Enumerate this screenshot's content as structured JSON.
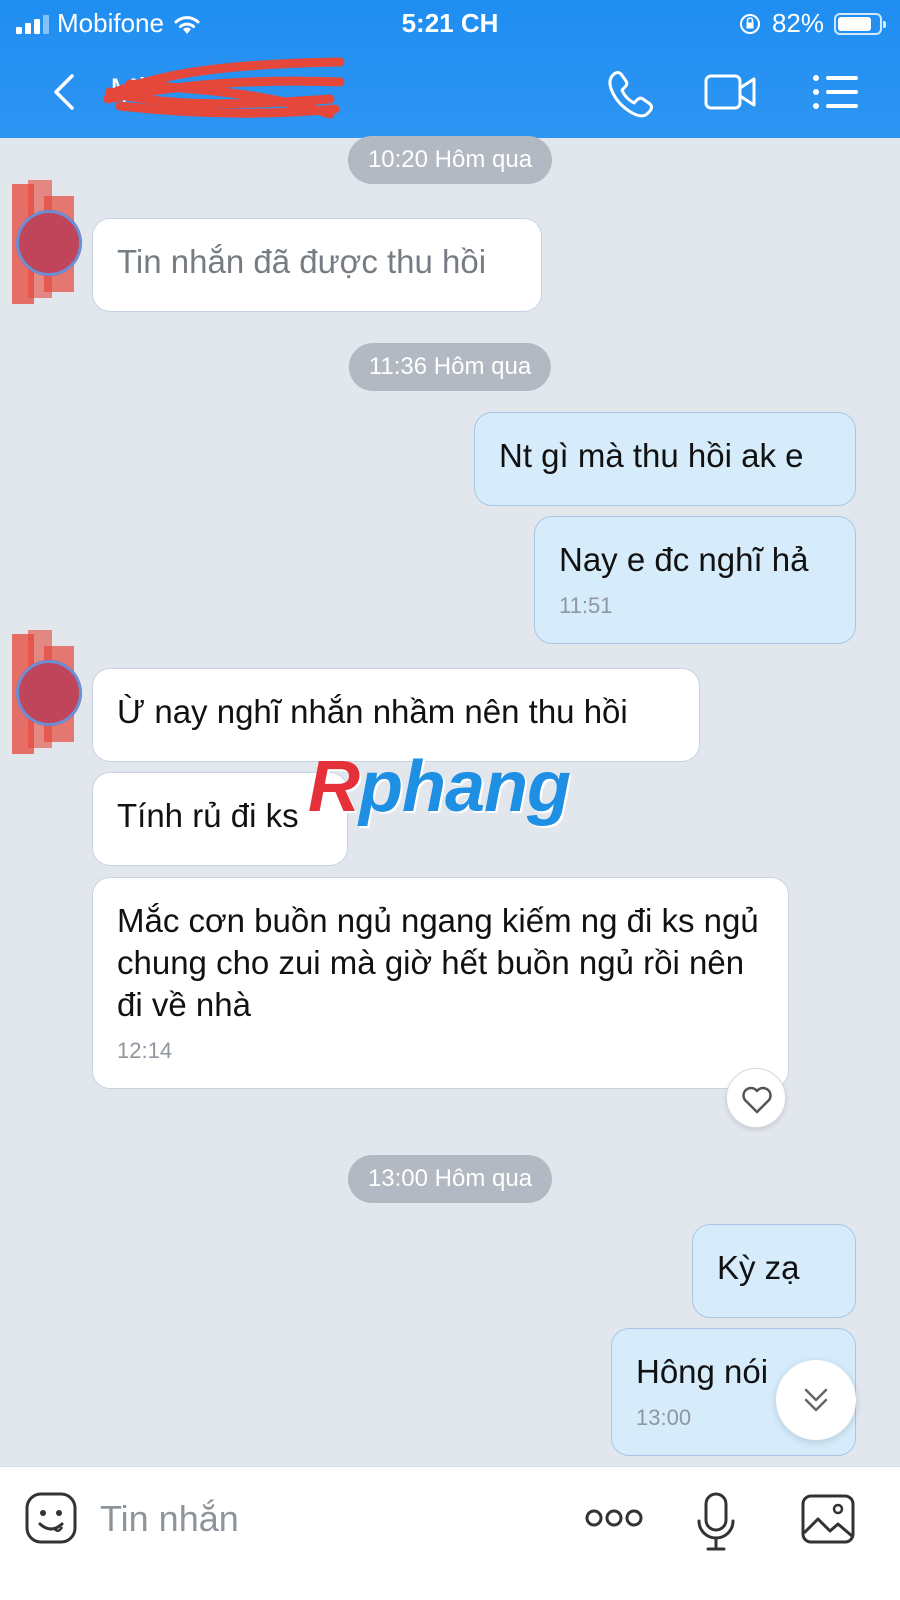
{
  "status_bar": {
    "carrier": "Mobifone",
    "time": "5:21 CH",
    "battery_percent": "82%",
    "battery_level": 0.82
  },
  "header": {
    "contact_name": "Mi...",
    "icons": [
      "back-icon",
      "phone-icon",
      "video-call-icon",
      "menu-icon"
    ]
  },
  "chat": {
    "separators": [
      {
        "label": "10:20 Hôm qua"
      },
      {
        "label": "11:36 Hôm qua"
      },
      {
        "label": "13:00 Hôm qua"
      }
    ],
    "messages": [
      {
        "side": "in",
        "text": "Tin nhắn đã được thu hồi",
        "recalled": true
      },
      {
        "side": "out",
        "text": "Nt gì mà thu hồi ak e"
      },
      {
        "side": "out",
        "text": "Nay e đc nghĩ hả",
        "time": "11:51"
      },
      {
        "side": "in",
        "text": "Ừ nay nghĩ nhắn nhầm nên thu hồi"
      },
      {
        "side": "in",
        "text": "Tính rủ đi ks"
      },
      {
        "side": "in",
        "text": "Mắc cơn buồn ngủ ngang kiếm ng đi ks ngủ chung cho zui mà giờ hết buồn ngủ rồi nên đi về nhà",
        "time": "12:14"
      },
      {
        "side": "out",
        "text": "Kỳ zạ"
      },
      {
        "side": "out",
        "text": "Hông nói",
        "time": "13:00"
      }
    ]
  },
  "watermark": {
    "first": "R",
    "rest": "phang"
  },
  "input_bar": {
    "placeholder": "Tin nhắn",
    "icons": [
      "emoji-icon",
      "more-icon",
      "microphone-icon",
      "image-icon"
    ]
  },
  "colors": {
    "header": "#1f8ef1",
    "chat_background": "#e2e7ee",
    "outgoing_bubble": "#d6ecfb",
    "incoming_bubble": "#ffffff"
  }
}
